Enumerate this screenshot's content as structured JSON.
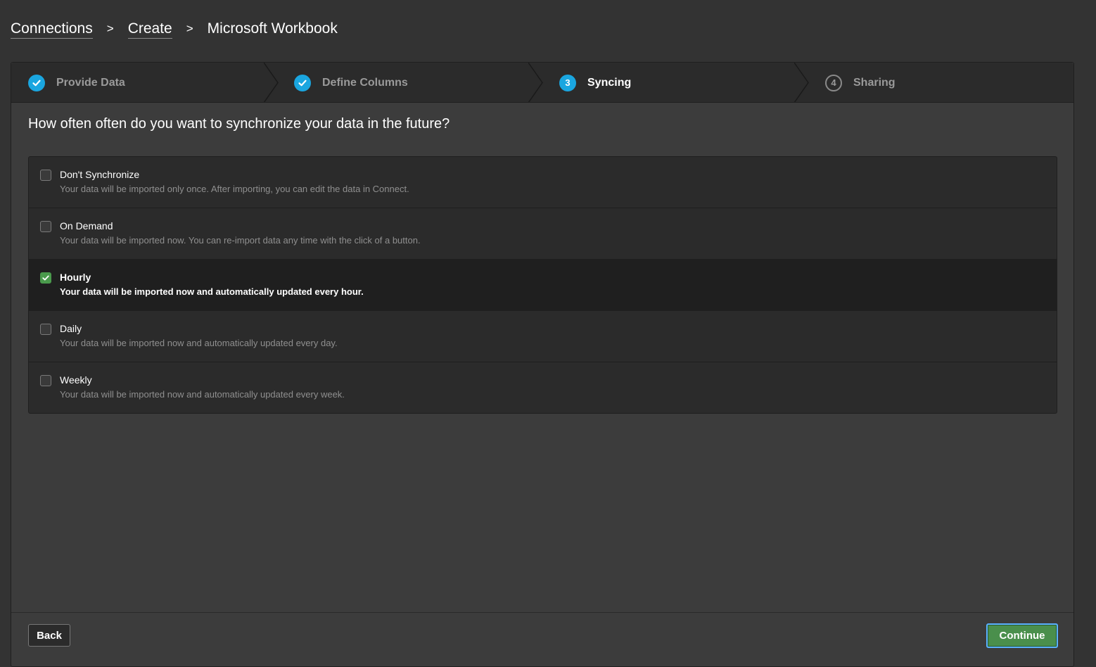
{
  "breadcrumb": {
    "items": [
      {
        "label": "Connections"
      },
      {
        "label": "Create"
      }
    ],
    "separator": ">",
    "current": "Microsoft Workbook"
  },
  "steps": [
    {
      "label": "Provide Data",
      "status": "done"
    },
    {
      "label": "Define Columns",
      "status": "done"
    },
    {
      "label": "Syncing",
      "status": "current",
      "number": "3"
    },
    {
      "label": "Sharing",
      "status": "pending",
      "number": "4"
    }
  ],
  "question": "How often often do you want to synchronize your data in the future?",
  "options": [
    {
      "title": "Don't Synchronize",
      "description": "Your data will be imported only once. After importing, you can edit the data in Connect.",
      "checked": false
    },
    {
      "title": "On Demand",
      "description": "Your data will be imported now. You can re-import data any time with the click of a button.",
      "checked": false
    },
    {
      "title": "Hourly",
      "description": "Your data will be imported now and automatically updated every hour.",
      "checked": true
    },
    {
      "title": "Daily",
      "description": "Your data will be imported now and automatically updated every day.",
      "checked": false
    },
    {
      "title": "Weekly",
      "description": "Your data will be imported now and automatically updated every week.",
      "checked": false
    }
  ],
  "buttons": {
    "back": "Back",
    "continue": "Continue"
  },
  "colors": {
    "accent": "#1aa6e0",
    "success": "#4a9a4c",
    "focus": "#5ab2ff"
  }
}
